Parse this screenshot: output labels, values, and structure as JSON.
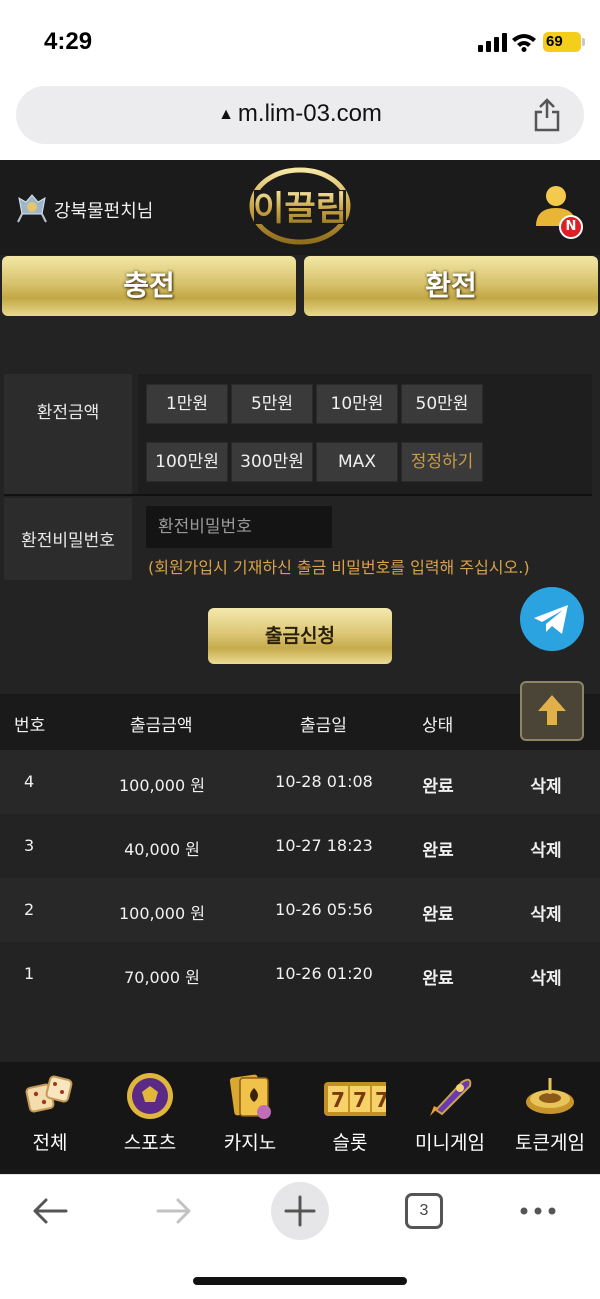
{
  "status_bar": {
    "time": "4:29",
    "battery": "69"
  },
  "address_bar": {
    "url": "m.lim-03.com"
  },
  "header": {
    "username": "강북물펀치님",
    "logo_text": "이끌림",
    "notification_badge": "N"
  },
  "buttons": {
    "charge": "충전",
    "exchange": "환전"
  },
  "form": {
    "amount_label": "환전금액",
    "amount_options": [
      "1만원",
      "5만원",
      "10만원",
      "50만원",
      "100만원",
      "300만원",
      "MAX",
      "정정하기"
    ],
    "password_label": "환전비밀번호",
    "password_placeholder": "환전비밀번호",
    "password_hint": "(회원가입시 기재하신 출금 비밀번호를 입력해 주십시오.)",
    "submit_label": "출금신청"
  },
  "table": {
    "headers": [
      "번호",
      "출금금액",
      "출금일",
      "상태"
    ],
    "rows": [
      {
        "no": "4",
        "amount": "100,000 원",
        "date": "10-28 01:08",
        "status": "완료",
        "action": "삭제"
      },
      {
        "no": "3",
        "amount": "40,000 원",
        "date": "10-27 18:23",
        "status": "완료",
        "action": "삭제"
      },
      {
        "no": "2",
        "amount": "100,000 원",
        "date": "10-26 05:56",
        "status": "완료",
        "action": "삭제"
      },
      {
        "no": "1",
        "amount": "70,000 원",
        "date": "10-26 01:20",
        "status": "완료",
        "action": "삭제"
      }
    ]
  },
  "bottom_nav": [
    {
      "label": "전체",
      "icon": "dice-icon"
    },
    {
      "label": "스포츠",
      "icon": "soccer-ball-icon"
    },
    {
      "label": "카지노",
      "icon": "cards-icon"
    },
    {
      "label": "슬롯",
      "icon": "slot-777-icon"
    },
    {
      "label": "미니게임",
      "icon": "rocket-icon"
    },
    {
      "label": "토큰게임",
      "icon": "roulette-icon"
    }
  ],
  "browser_toolbar": {
    "tab_count": "3"
  },
  "colors": {
    "gold": "#d8c36e",
    "hint": "#d9a24a",
    "badge": "#e01e26",
    "telegram": "#2aa3e0",
    "site_bg": "#232323"
  }
}
